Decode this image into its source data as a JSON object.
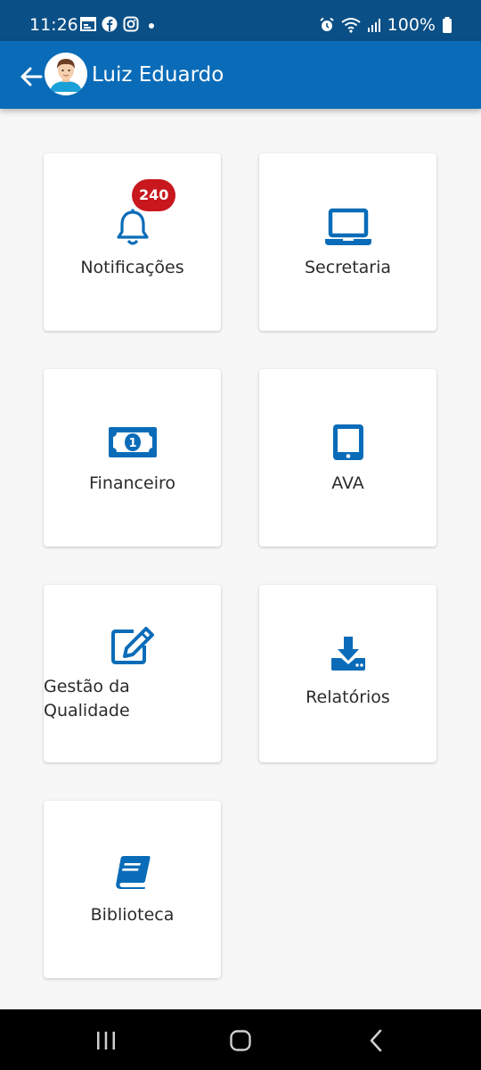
{
  "status_bar": {
    "time": "11:26",
    "battery": "100%",
    "left_icons": [
      "calendar-icon",
      "facebook-icon",
      "instagram-icon",
      "dot-icon"
    ],
    "right_icons": [
      "alarm-icon",
      "wifi-icon",
      "signal-icon",
      "battery-icon"
    ]
  },
  "header": {
    "back_icon": "arrow-left-icon",
    "avatar": "user-avatar",
    "user_name": "Luiz Eduardo"
  },
  "menu": [
    {
      "label": "Notificações",
      "icon": "bell-icon",
      "badge": "240"
    },
    {
      "label": "Secretaria",
      "icon": "laptop-icon"
    },
    {
      "label": "Financeiro",
      "icon": "money-bill-icon"
    },
    {
      "label": "AVA",
      "icon": "tablet-icon"
    },
    {
      "label": "Gestão da Qualidade",
      "icon": "edit-icon"
    },
    {
      "label": "Relatórios",
      "icon": "download-icon"
    },
    {
      "label": "Biblioteca",
      "icon": "book-icon"
    }
  ],
  "nav_bar": {
    "icons": [
      "recent-apps-icon",
      "home-icon",
      "back-icon"
    ]
  },
  "colors": {
    "status_bar": "#0a4f86",
    "app_bar": "#0a6cb8",
    "icon_blue": "#0a6cb8",
    "badge_red": "#c8171d",
    "background": "#f7f7f7"
  }
}
